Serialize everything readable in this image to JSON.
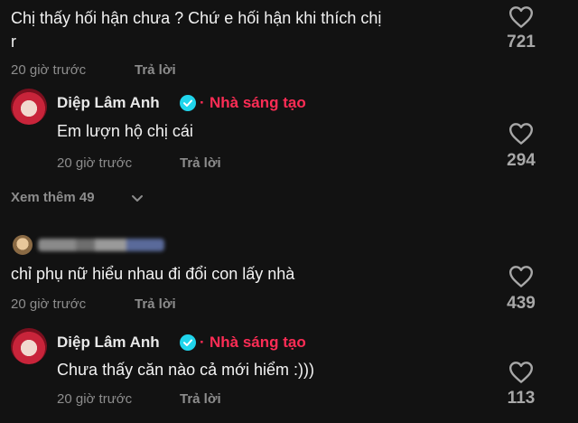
{
  "comments": [
    {
      "text_line1": "Chị thấy hối hận chưa ? Chứ e hối hận khi thích chị",
      "text_line2": "r",
      "time": "20 giờ trước",
      "reply_label": "Trả lời",
      "likes": "721",
      "reply": {
        "author": "Diệp Lâm Anh",
        "badge": "Nhà sáng tạo",
        "text": "Em lượn hộ chị cái",
        "time": "20 giờ trước",
        "reply_label": "Trả lời",
        "likes": "294"
      },
      "see_more": "Xem thêm 49"
    },
    {
      "text": "chỉ phụ nữ hiểu nhau đi đổi con lấy nhà",
      "time": "20 giờ trước",
      "reply_label": "Trả lời",
      "likes": "439",
      "reply": {
        "author": "Diệp Lâm Anh",
        "badge": "Nhà sáng tạo",
        "text": "Chưa thấy căn nào cả mới hiểm :)))",
        "time": "20 giờ trước",
        "reply_label": "Trả lời",
        "likes": "113"
      }
    }
  ],
  "colors": {
    "background": "#121212",
    "creator_badge": "#fe2c55",
    "verified": "#20d5ec"
  },
  "icons": {
    "like": "heart-outline-icon",
    "verified": "verified-check-icon",
    "expand": "chevron-down-icon"
  }
}
